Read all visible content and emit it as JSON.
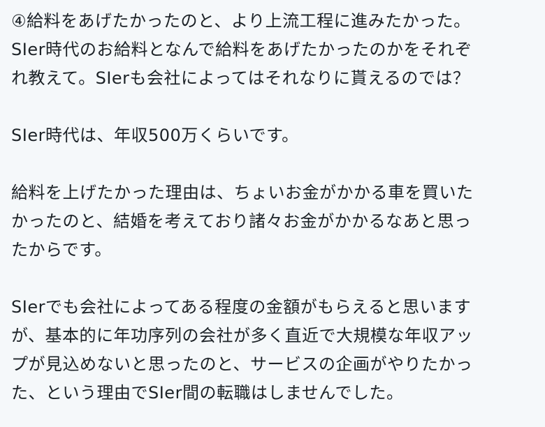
{
  "paragraphs": [
    {
      "lines": [
        "④給料をあげたかったのと、より上流工程に進みたかった。",
        "SIer時代のお給料となんで給料をあげたかったのかをそれぞ",
        "れ教えて。SIerも会社によってはそれなりに貰えるのでは？"
      ]
    },
    {
      "lines": [
        "SIer時代は、年収500万くらいです。"
      ]
    },
    {
      "lines": [
        "給料を上げたかった理由は、ちょいお金がかかる車を買いた",
        "かったのと、結婚を考えており諸々お金がかかるなあと思っ",
        "たからです。"
      ]
    },
    {
      "lines": [
        "SIerでも会社によってある程度の金額がもらえると思います",
        "が、基本的に年功序列の会社が多く直近で大規模な年収アッ",
        "プが見込めないと思ったのと、サービスの企画がやりたかっ",
        "た、という理由でSIer間の転職はしませんでした。"
      ]
    }
  ]
}
